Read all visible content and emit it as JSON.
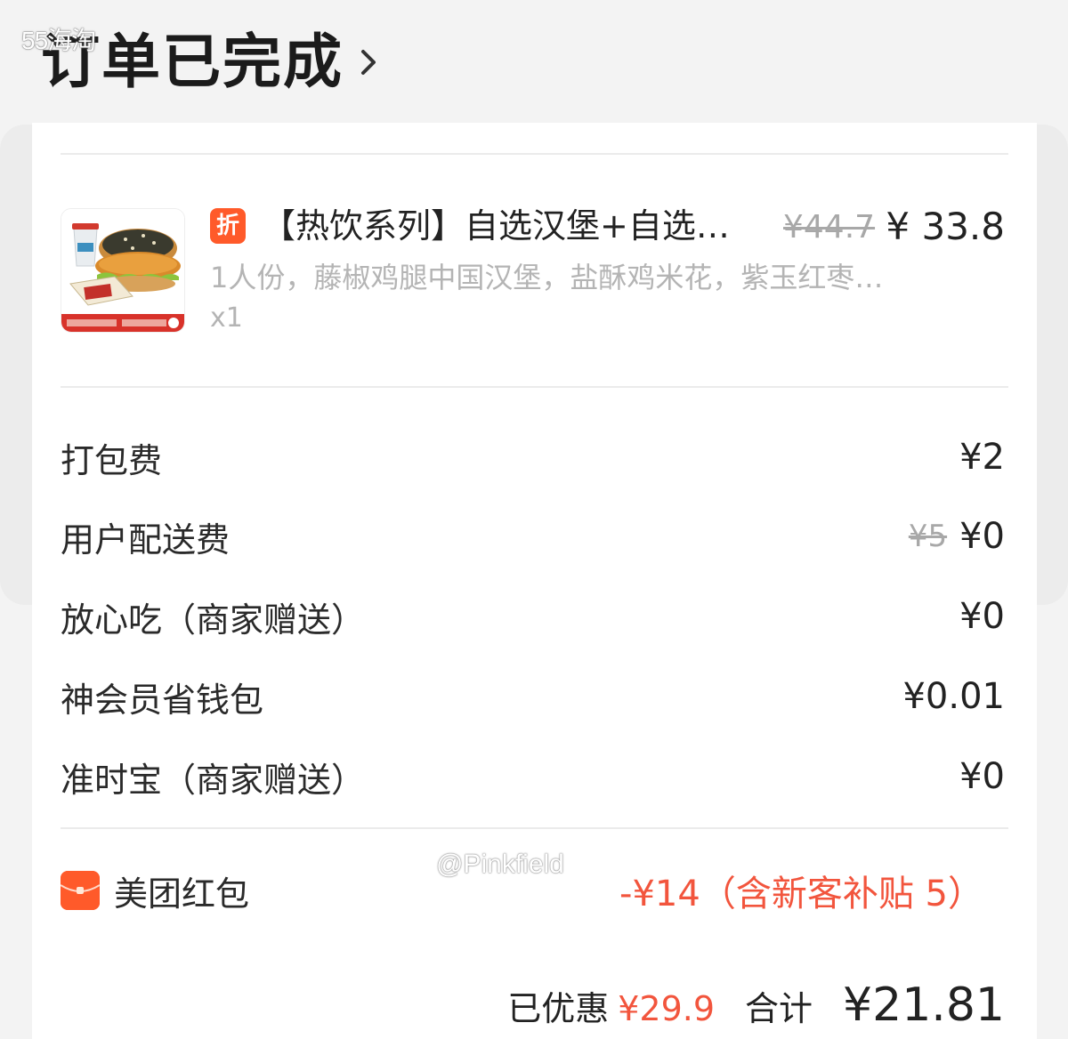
{
  "watermarks": {
    "top": "55海淘",
    "bottom": "@Pinkfield"
  },
  "header": {
    "title": "订单已完成",
    "chevron_icon": "chevron-right-icon"
  },
  "product": {
    "image_icon": "burger-combo-image",
    "badge": "折",
    "name": "【热饮系列】自选汉堡+自选…",
    "original_price": "¥44.7",
    "price": "¥ 33.8",
    "description": "1人份，藤椒鸡腿中国汉堡，盐酥鸡米花，紫玉红枣…",
    "quantity": "x1"
  },
  "fees": [
    {
      "label": "打包费",
      "value": "¥2"
    },
    {
      "label": "用户配送费",
      "original": "¥5",
      "value": "¥0"
    },
    {
      "label": "放心吃（商家赠送）",
      "value": "¥0"
    },
    {
      "label": "神会员省钱包",
      "value": "¥0.01"
    },
    {
      "label": "准时宝（商家赠送）",
      "value": "¥0"
    }
  ],
  "red_packet": {
    "icon": "red-envelope-icon",
    "label": "美团红包",
    "value": "-¥14（含新客补贴 5）"
  },
  "totals": {
    "saved_label": "已优惠",
    "saved_value": "¥29.9",
    "sum_label": "合计",
    "sum_value": "¥21.81"
  },
  "colors": {
    "accent": "#f2553d",
    "badge": "#ff5a2a",
    "muted": "#b4b4b4"
  }
}
